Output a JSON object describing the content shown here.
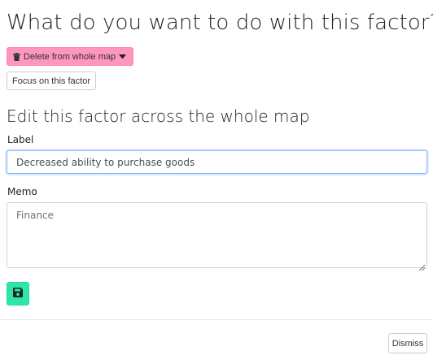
{
  "dialog": {
    "title": "What do you want to do with this factor?",
    "delete_button": {
      "label": "Delete from whole map",
      "icon": "trash-icon",
      "caret_icon": "caret-down-icon",
      "color": "#ff96bd"
    },
    "focus_button": {
      "label": "Focus on this factor"
    },
    "edit_section": {
      "title": "Edit this factor across the whole map",
      "label_field": {
        "label": "Label",
        "value": "Decreased ability to purchase goods"
      },
      "memo_field": {
        "label": "Memo",
        "value": "Finance"
      },
      "save_button": {
        "icon": "floppy-disk-icon",
        "color": "#2ee6a8"
      }
    },
    "footer": {
      "dismiss_label": "Dismiss"
    }
  }
}
